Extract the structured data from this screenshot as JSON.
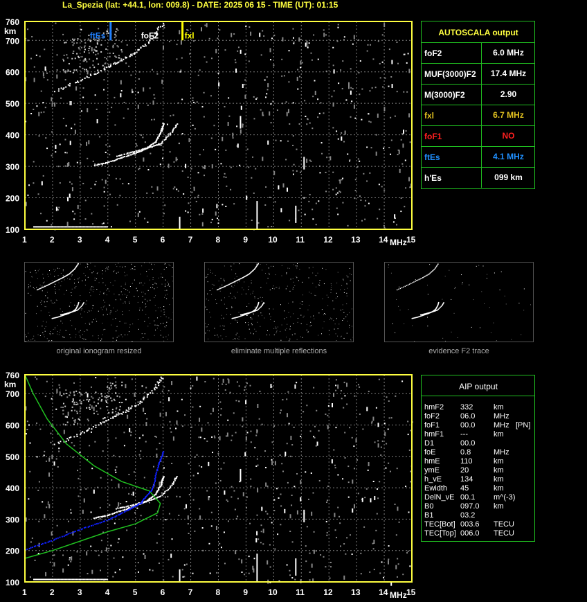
{
  "title": "La_Spezia (lat: +44.1, lon: 009.8) - DATE: 2025 06 15 - TIME (UT): 01:15",
  "colors": {
    "axis": "#ffff40",
    "grid": "#808080",
    "fte": "#2080ff",
    "fxl": "#ffff00",
    "green": "#20c020",
    "blue": "#1020ff",
    "red": "#ff2020"
  },
  "axes": {
    "x_ticks": [
      "1",
      "2",
      "3",
      "4",
      "5",
      "6",
      "7",
      "8",
      "9",
      "10",
      "11",
      "12",
      "13",
      "14",
      "15"
    ],
    "x_unit": "MHz",
    "y_ticks": [
      "100",
      "200",
      "300",
      "400",
      "500",
      "600",
      "700",
      "760"
    ],
    "y_unit": "km"
  },
  "markers": {
    "ftEs": "ftEs",
    "foF2": "foF2",
    "fxl": "fxl"
  },
  "autoscala": {
    "title": "AUTOSCALA output",
    "rows": [
      {
        "key": "foF2",
        "val": "6.0 MHz",
        "color": "#ffffff"
      },
      {
        "key": "MUF(3000)F2",
        "val": "17.4 MHz",
        "color": "#ffffff"
      },
      {
        "key": "M(3000)F2",
        "val": "2.90",
        "color": "#ffffff"
      },
      {
        "key": "fxl",
        "val": "6.7 MHz",
        "color": "#e0c020"
      },
      {
        "key": "foF1",
        "val": "NO",
        "color": "#ff2020"
      },
      {
        "key": "ftEs",
        "val": "4.1 MHz",
        "color": "#2090ff"
      },
      {
        "key": "h'Es",
        "val": "099    km",
        "color": "#ffffff"
      }
    ]
  },
  "thumbs": {
    "cap1": "original ionogram resized",
    "cap2": "eliminate multiple reflections",
    "cap3": "evidence F2 trace"
  },
  "aip": {
    "title": "AIP output",
    "rows": [
      [
        "hmF2",
        "332",
        "km",
        ""
      ],
      [
        "foF2",
        "06.0",
        "MHz",
        ""
      ],
      [
        "foF1",
        "00.0",
        "MHz",
        "[PN]"
      ],
      [
        "hmF1",
        "---",
        "km",
        ""
      ],
      [
        "D1",
        "00.0",
        "",
        ""
      ],
      [
        "foE",
        "0.8",
        "MHz",
        ""
      ],
      [
        "hmE",
        "110",
        "km",
        ""
      ],
      [
        "ymE",
        "20",
        "km",
        ""
      ],
      [
        "h_vE",
        "134",
        "km",
        ""
      ],
      [
        "Ewidth",
        "45",
        "km",
        ""
      ],
      [
        "DelN_vE",
        "00.1",
        "m^(-3)",
        ""
      ],
      [
        "B0",
        "097.0",
        "km",
        ""
      ],
      [
        "B1",
        "03.2",
        "",
        ""
      ],
      [
        "TEC[Bot]",
        "003.6",
        "TECU",
        ""
      ],
      [
        "TEC[Top]",
        "006.0",
        "TECU",
        ""
      ]
    ]
  },
  "chart_data": {
    "type": "scatter",
    "xlim": [
      1,
      15
    ],
    "ylim": [
      100,
      760
    ],
    "xlabel": "MHz",
    "ylabel": "km",
    "grid": true,
    "f2_trace_o": [
      [
        3.5,
        305
      ],
      [
        4.0,
        315
      ],
      [
        4.5,
        330
      ],
      [
        5.0,
        345
      ],
      [
        5.4,
        360
      ],
      [
        5.7,
        380
      ],
      [
        5.9,
        410
      ],
      [
        6.0,
        440
      ]
    ],
    "f2_trace_x": [
      [
        4.3,
        335
      ],
      [
        4.8,
        345
      ],
      [
        5.2,
        355
      ],
      [
        5.6,
        365
      ],
      [
        5.9,
        375
      ],
      [
        6.3,
        410
      ],
      [
        6.5,
        440
      ]
    ],
    "f2_multiple_o": [
      [
        2.1,
        540
      ],
      [
        3.0,
        575
      ],
      [
        3.8,
        610
      ],
      [
        4.5,
        640
      ],
      [
        5.1,
        670
      ],
      [
        5.6,
        710
      ],
      [
        6.0,
        760
      ]
    ],
    "es_trace": [
      [
        1.3,
        110
      ],
      [
        2.0,
        110
      ],
      [
        3.0,
        110
      ],
      [
        4.0,
        110
      ]
    ],
    "aip_green_profile": [
      [
        1.0,
        175
      ],
      [
        2.0,
        200
      ],
      [
        3.0,
        230
      ],
      [
        4.0,
        260
      ],
      [
        5.0,
        285
      ],
      [
        5.8,
        320
      ],
      [
        5.9,
        350
      ],
      [
        5.5,
        390
      ],
      [
        4.5,
        420
      ],
      [
        3.5,
        470
      ],
      [
        2.5,
        540
      ],
      [
        1.8,
        620
      ],
      [
        1.3,
        700
      ],
      [
        1.0,
        760
      ]
    ],
    "aip_blue_profile": [
      [
        1.0,
        205
      ],
      [
        2.0,
        235
      ],
      [
        3.0,
        270
      ],
      [
        4.0,
        300
      ],
      [
        4.7,
        330
      ],
      [
        5.2,
        355
      ],
      [
        5.6,
        400
      ],
      [
        5.8,
        470
      ],
      [
        6.0,
        520
      ]
    ]
  }
}
